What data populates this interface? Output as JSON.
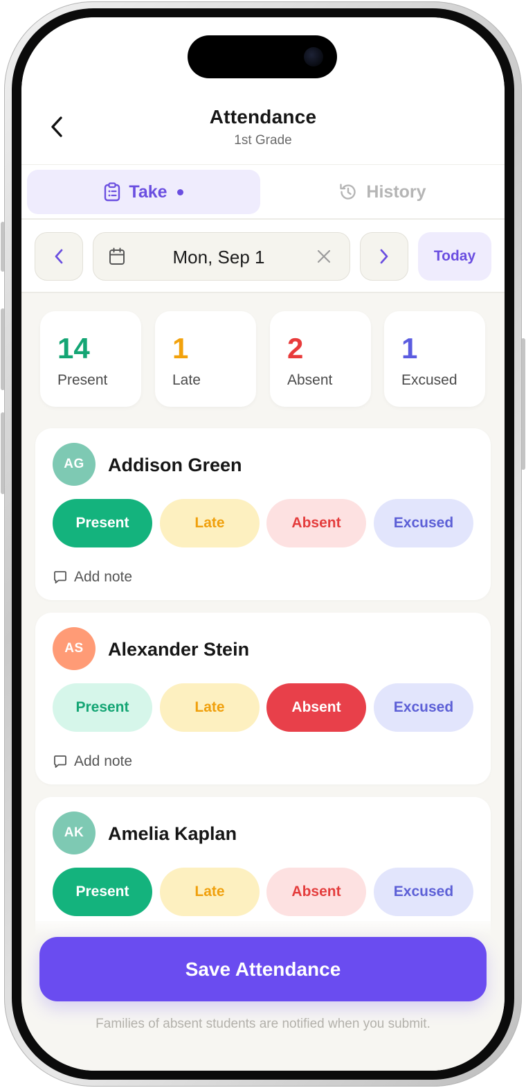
{
  "header": {
    "title": "Attendance",
    "subtitle": "1st Grade"
  },
  "tabs": [
    {
      "label": "Take",
      "active": true
    },
    {
      "label": "History",
      "active": false
    }
  ],
  "date_picker": {
    "value": "Mon, Sep 1",
    "today_label": "Today"
  },
  "summary": [
    {
      "count": "14",
      "label": "Present",
      "color": "#14a574"
    },
    {
      "count": "1",
      "label": "Late",
      "color": "#f2a20c"
    },
    {
      "count": "2",
      "label": "Absent",
      "color": "#e83b3b"
    },
    {
      "count": "1",
      "label": "Excused",
      "color": "#5b5ce0"
    }
  ],
  "status_labels": {
    "present": "Present",
    "late": "Late",
    "absent": "Absent",
    "excused": "Excused"
  },
  "students": [
    {
      "initials": "AG",
      "name": "Addison Green",
      "avatar_color": "#7ec9b3",
      "status": "present",
      "note_label": "Add note"
    },
    {
      "initials": "AS",
      "name": "Alexander Stein",
      "avatar_color": "#ff9b76",
      "status": "absent",
      "note_label": "Add note"
    },
    {
      "initials": "AK",
      "name": "Amelia Kaplan",
      "avatar_color": "#7ec9b3",
      "status": "present"
    }
  ],
  "footer": {
    "save_label": "Save Attendance",
    "note": "Families of absent students are notified when you submit."
  },
  "colors": {
    "accent": "#6a4cf0",
    "present": "#14b37d",
    "late_text": "#f0a00c",
    "absent": "#e8404a",
    "excused_text": "#5c5fd6"
  }
}
